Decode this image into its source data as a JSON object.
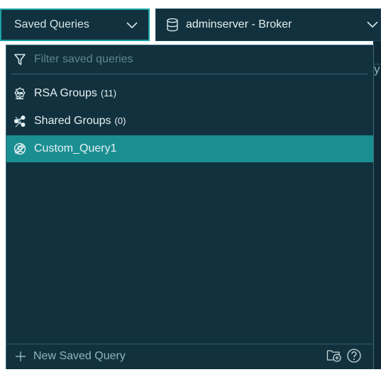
{
  "header": {
    "saved_queries_label": "Saved Queries",
    "data_source_label": "adminserver - Broker"
  },
  "filter": {
    "placeholder": "Filter saved queries",
    "value": ""
  },
  "list": [
    {
      "label": "RSA Groups",
      "count": "(11)",
      "icon": "live-icon"
    },
    {
      "label": "Shared Groups",
      "count": "(0)",
      "icon": "share-icon"
    },
    {
      "label": "Custom_Query1",
      "icon": "user-icon",
      "selected": true
    }
  ],
  "footer": {
    "new_label": "New Saved Query"
  },
  "background": {
    "right_text": "y"
  },
  "colors": {
    "panel": "#12313e",
    "accent": "#1aa3a3",
    "selected_row": "#1a8f92"
  }
}
